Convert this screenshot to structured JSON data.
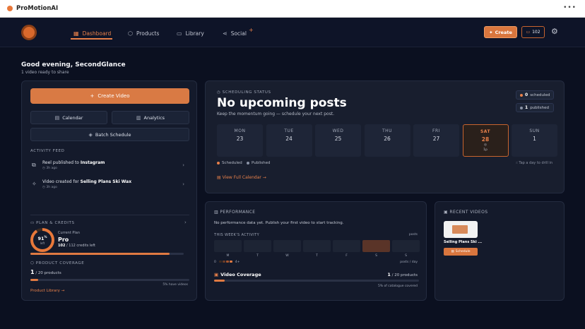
{
  "window": {
    "title": "ProMotionAI",
    "menu_icon": "ellipsis-icon"
  },
  "nav": {
    "items": [
      {
        "label": "Dashboard",
        "icon": "grid-icon",
        "active": true
      },
      {
        "label": "Products",
        "icon": "box-icon"
      },
      {
        "label": "Library",
        "icon": "video-icon"
      },
      {
        "label": "Social",
        "icon": "share-icon"
      }
    ],
    "create_label": "Create",
    "credits": "102"
  },
  "greeting": {
    "title": "Good evening, SecondGlance",
    "subtitle": "1 video ready to share"
  },
  "left": {
    "create_video": "Create Video",
    "calendar": "Calendar",
    "analytics": "Analytics",
    "batch": "Batch Schedule",
    "activity_title": "ACTIVITY FEED",
    "activity": [
      {
        "text": "Reel published to ",
        "bold": "Instagram",
        "time": "3h ago"
      },
      {
        "text": "Video created for ",
        "bold": "Selling Plans Ski Wax",
        "time": "3h ago"
      }
    ],
    "plan_title": "PLAN & CREDITS",
    "ring_pct": "91",
    "ring_sup": "%",
    "ring_left": "left",
    "plan_current_label": "Current Plan",
    "plan_name": "Pro",
    "plan_credits_used": "102",
    "plan_credits_rest": " / 112 credits left",
    "plan_fraction": 0.91,
    "coverage_title": "PRODUCT COVERAGE",
    "coverage_count": "1",
    "coverage_rest": " / 20 products",
    "coverage_fraction": 0.05,
    "coverage_pct": "5% have videos",
    "product_library": "Product Library →"
  },
  "schedule": {
    "label": "SCHEDULING STATUS",
    "title": "No upcoming posts",
    "subtitle": "Keep the momentum going — schedule your next post.",
    "scheduled_count": "0",
    "scheduled_label": "scheduled",
    "published_count": "1",
    "published_label": "published",
    "days": [
      {
        "name": "MON",
        "num": "23"
      },
      {
        "name": "TUE",
        "num": "24"
      },
      {
        "name": "WED",
        "num": "25"
      },
      {
        "name": "THU",
        "num": "26"
      },
      {
        "name": "FRI",
        "num": "27"
      },
      {
        "name": "SAT",
        "num": "28",
        "today": true,
        "extra1": "◎",
        "extra2": "1p"
      },
      {
        "name": "SUN",
        "num": "1"
      }
    ],
    "legend_scheduled": "Scheduled",
    "legend_published": "Published",
    "hint": "Tap a day to drill in",
    "full_calendar": "View Full Calendar →",
    "colors": {
      "scheduled": "#e8804a",
      "published": "#8a93a6"
    }
  },
  "performance": {
    "label": "PERFORMANCE",
    "message": "No performance data yet. Publish your first video to start tracking.",
    "week_label": "THIS WEEK'S ACTIVITY",
    "posts_label": "posts",
    "days": [
      "M",
      "T",
      "W",
      "T",
      "F",
      "S",
      "S"
    ],
    "highlight_index": 5,
    "scale_min": "0",
    "scale_max": "4+",
    "per_day": "posts / day",
    "coverage_label": "Video Coverage",
    "coverage_count": "1",
    "coverage_rest": " / 20 products",
    "coverage_fraction": 0.05,
    "coverage_pct": "5% of catalogue covered"
  },
  "recent": {
    "label": "RECENT VIDEOS",
    "title": "Selling Plans Ski ...",
    "button": "Schedule"
  }
}
